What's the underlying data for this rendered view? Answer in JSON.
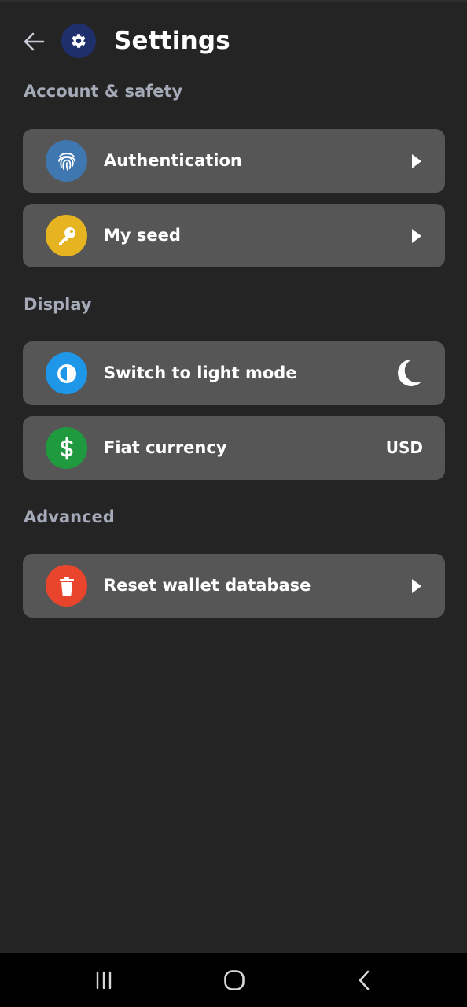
{
  "header": {
    "title": "Settings",
    "back_icon": "arrow-left-icon",
    "app_icon": "gear-icon"
  },
  "sections": [
    {
      "heading": "Account & safety",
      "items": [
        {
          "label": "Authentication",
          "icon": "fingerprint-icon",
          "icon_color": "#3f77b0",
          "trailing": "chevron-right-icon"
        },
        {
          "label": "My seed",
          "icon": "key-icon",
          "icon_color": "#e6b321",
          "trailing": "chevron-right-icon"
        }
      ]
    },
    {
      "heading": "Display",
      "items": [
        {
          "label": "Switch to light mode",
          "icon": "contrast-icon",
          "icon_color": "#1e97e8",
          "trailing": "moon-icon"
        },
        {
          "label": "Fiat currency",
          "icon": "dollar-icon",
          "icon_color": "#1f9a3e",
          "value": "USD"
        }
      ]
    },
    {
      "heading": "Advanced",
      "items": [
        {
          "label": "Reset wallet database",
          "icon": "trash-icon",
          "icon_color": "#e8452c",
          "trailing": "chevron-right-icon"
        }
      ]
    }
  ],
  "navbar": {
    "recent_icon": "recent-apps-icon",
    "home_icon": "home-icon",
    "back_icon": "back-icon"
  },
  "colors": {
    "background": "#242424",
    "card": "#565656",
    "section_heading": "#a4aab8",
    "header_badge": "#1f2f6b"
  }
}
